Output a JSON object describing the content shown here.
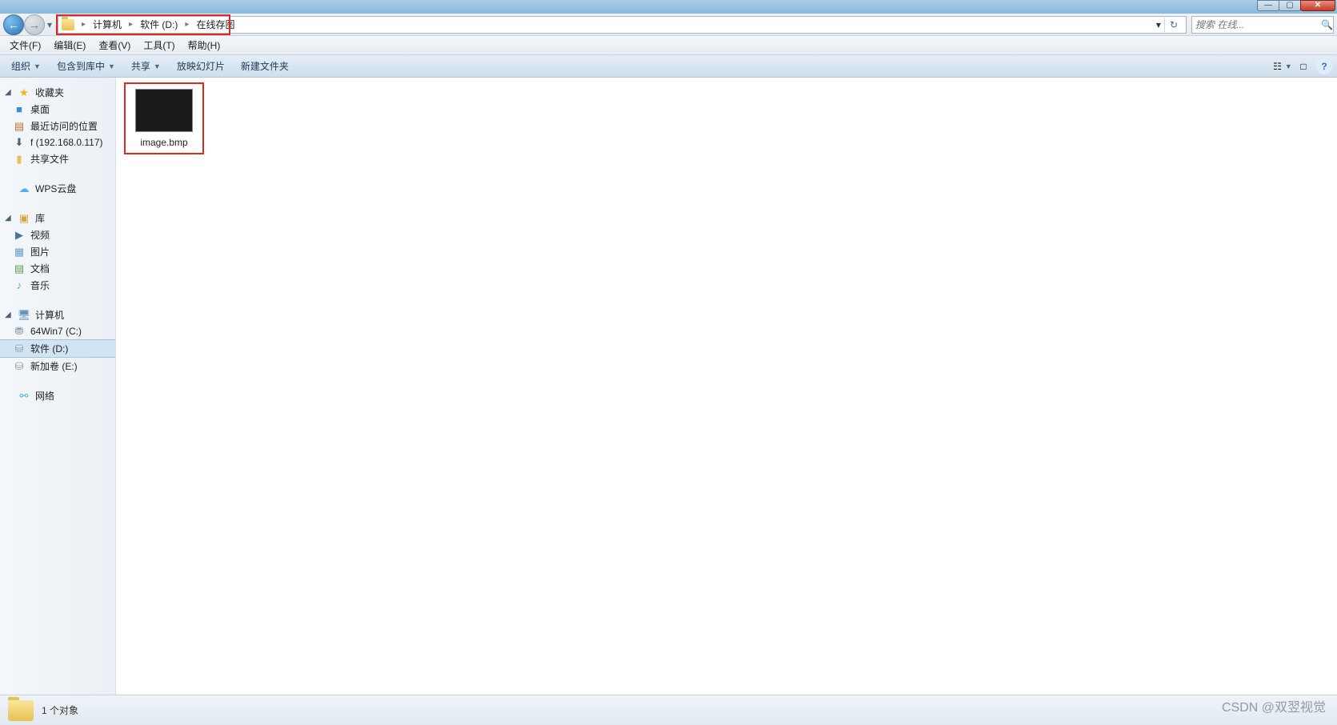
{
  "breadcrumb": {
    "item0": "计算机",
    "item1": "软件 (D:)",
    "item2": "在线存图"
  },
  "address_controls": {
    "dropdown": "▾",
    "refresh": "↻"
  },
  "search": {
    "placeholder": "搜索 在线...",
    "icon": "🔍"
  },
  "menus": {
    "file": "文件(F)",
    "edit": "编辑(E)",
    "view": "查看(V)",
    "tools": "工具(T)",
    "help": "帮助(H)"
  },
  "toolbar": {
    "organize": "组织",
    "include": "包含到库中",
    "share": "共享",
    "slideshow": "放映幻灯片",
    "newfolder": "新建文件夹"
  },
  "toolbar_icons": {
    "view": "☷",
    "preview": "□",
    "help": "?"
  },
  "sidebar": {
    "favorites": {
      "header": "收藏夹",
      "items": {
        "i0": "桌面",
        "i1": "最近访问的位置",
        "i2": "f (192.168.0.117)",
        "i3": "共享文件"
      }
    },
    "cloud": {
      "header": "WPS云盘"
    },
    "libraries": {
      "header": "库",
      "items": {
        "i0": "视频",
        "i1": "图片",
        "i2": "文档",
        "i3": "音乐"
      }
    },
    "computer": {
      "header": "计算机",
      "items": {
        "i0": "64Win7  (C:)",
        "i1": "软件 (D:)",
        "i2": "新加卷 (E:)"
      }
    },
    "network": {
      "header": "网络"
    }
  },
  "files": {
    "item0": {
      "name": "image.bmp"
    }
  },
  "details": {
    "text": "1 个对象"
  },
  "window_controls": {
    "min": "—",
    "max": "▢",
    "close": "✕"
  },
  "nav_glyphs": {
    "back": "←",
    "forward": "→",
    "dd": "▾"
  },
  "watermark": "CSDN @双翌视觉"
}
